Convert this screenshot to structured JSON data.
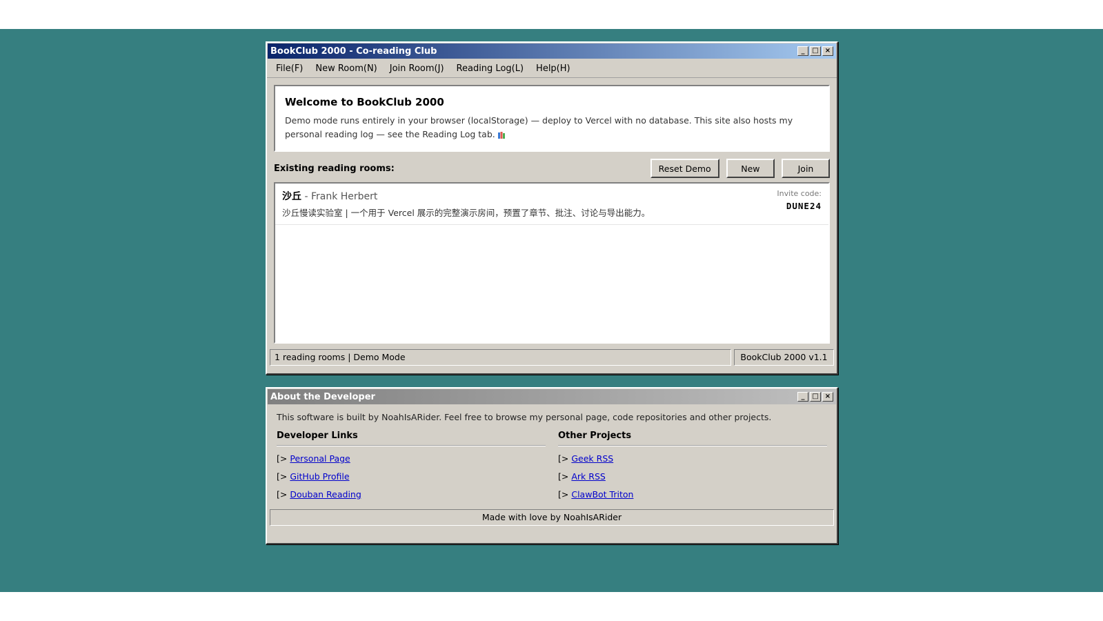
{
  "main_window": {
    "title": "BookClub 2000 - Co-reading Club",
    "controls": {
      "minimize": "_",
      "maximize": "□",
      "close": "×"
    },
    "menu": [
      "File(F)",
      "New Room(N)",
      "Join Room(J)",
      "Reading Log(L)",
      "Help(H)"
    ],
    "welcome": {
      "heading": "Welcome to BookClub 2000",
      "text": "Demo mode runs entirely in your browser (localStorage) — deploy to Vercel with no database. This site also hosts my personal reading log — see the Reading Log tab."
    },
    "rooms_label": "Existing reading rooms:",
    "buttons": {
      "reset": "Reset Demo",
      "new": "New",
      "join": "Join"
    },
    "rooms": [
      {
        "title": "沙丘",
        "author": "- Frank Herbert",
        "description": "沙丘慢读实验室 | 一个用于 Vercel 展示的完整演示房间，预置了章节、批注、讨论与导出能力。",
        "invite_label": "Invite code:",
        "invite_code": "DUNE24"
      }
    ],
    "status_left": "1 reading rooms | Demo Mode",
    "status_right": "BookClub 2000 v1.1"
  },
  "dev_window": {
    "title": "About the Developer",
    "intro": "This software is built by NoahIsARider. Feel free to browse my personal page, code repositories and other projects.",
    "link_prefix": "[>",
    "dev_links_heading": "Developer Links",
    "dev_links": [
      "Personal Page",
      "GitHub Profile",
      "Douban Reading"
    ],
    "projects_heading": "Other Projects",
    "projects": [
      "Geek RSS",
      "Ark RSS",
      "ClawBot Triton"
    ],
    "footer": "Made with love by NoahIsARider"
  },
  "colors": {
    "desktop": "#367f80",
    "window": "#d4d0c8",
    "title_active": "#0a246a",
    "title_inactive": "#808080",
    "link": "#0000cc"
  }
}
